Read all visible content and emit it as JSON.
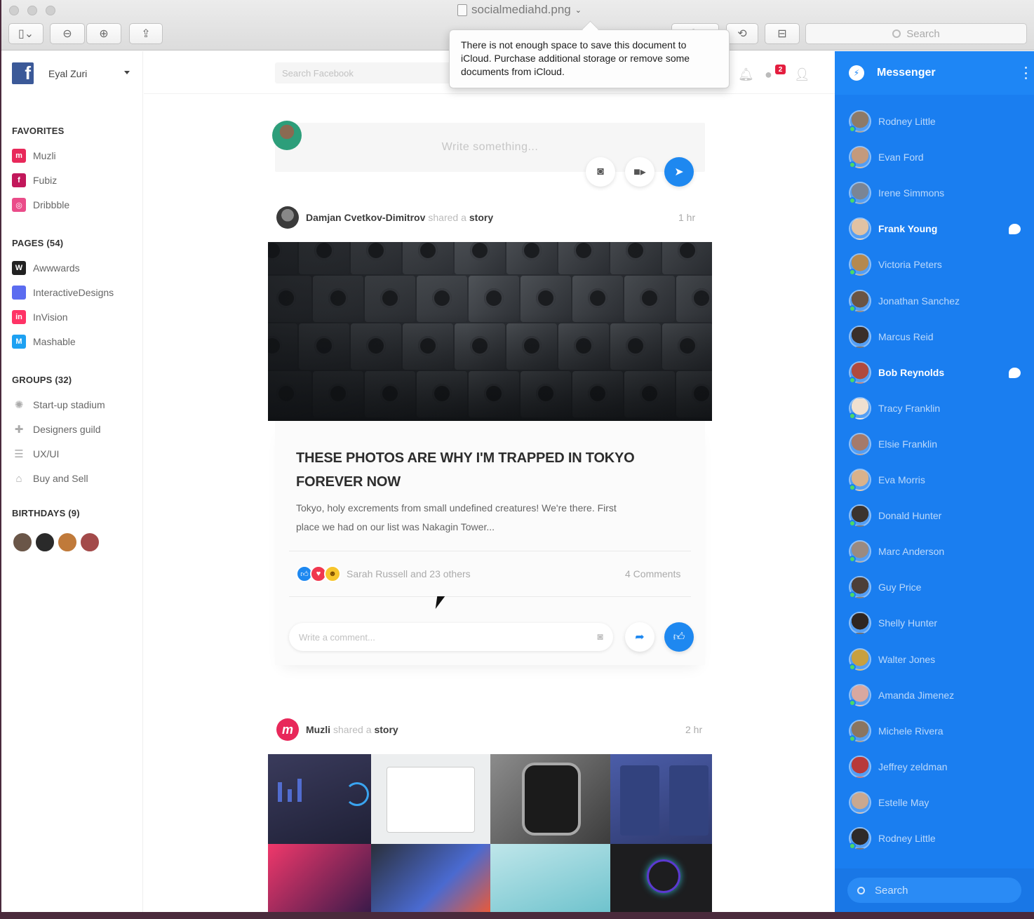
{
  "window": {
    "title": "socialmediahd.png",
    "toolbar_search_placeholder": "Search"
  },
  "tooltip": {
    "message": "There is not enough space to save this document to iCloud. Purchase additional storage or remove some documents from iCloud."
  },
  "profile": {
    "name": "Eyal Zuri"
  },
  "topbar": {
    "search_placeholder": "Search Facebook",
    "messages_badge": "2"
  },
  "sidebar": {
    "favorites_title": "FAVORITES",
    "favorites": [
      {
        "label": "Muzli",
        "icon": "muzli-icon",
        "color": "#e8285a",
        "glyph": "m"
      },
      {
        "label": "Fubiz",
        "icon": "fubiz-icon",
        "color": "#c2185b",
        "glyph": "f"
      },
      {
        "label": "Dribbble",
        "icon": "dribbble-icon",
        "color": "#ea4c89",
        "glyph": "◎"
      }
    ],
    "pages_title": "PAGES (54)",
    "pages": [
      {
        "label": "Awwwards",
        "icon": "awwwards-icon",
        "color": "#222222",
        "glyph": "W"
      },
      {
        "label": "InteractiveDesigns",
        "icon": "interactivedesigns-icon",
        "color": "#5b6cf0",
        "glyph": ""
      },
      {
        "label": "InVision",
        "icon": "invision-icon",
        "color": "#ff3366",
        "glyph": "in"
      },
      {
        "label": "Mashable",
        "icon": "mashable-icon",
        "color": "#1da1f2",
        "glyph": "M"
      }
    ],
    "groups_title": "GROUPS (32)",
    "groups": [
      {
        "label": "Start-up stadium",
        "icon": "lightbulb-icon",
        "glyph": "✺"
      },
      {
        "label": "Designers guild",
        "icon": "puzzle-icon",
        "glyph": "✚"
      },
      {
        "label": "UX/UI",
        "icon": "server-icon",
        "glyph": "☰"
      },
      {
        "label": "Buy and Sell",
        "icon": "basket-icon",
        "glyph": "⌂"
      }
    ],
    "birthdays_title": "BIRTHDAYS (9)"
  },
  "composer": {
    "placeholder": "Write something..."
  },
  "post1": {
    "author": "Damjan Cvetkov-Dimitrov",
    "action": "shared a",
    "object": "story",
    "time": "1 hr",
    "headline": "THESE PHOTOS ARE WHY I'M TRAPPED IN TOKYO FOREVER NOW",
    "excerpt": "Tokyo, holy excrements from small undefined creatures! We're there. First place we had on our list was Nakagin Tower...",
    "reactions": "Sarah Russell and 23 others",
    "comments": "4 Comments",
    "comment_placeholder": "Write a comment..."
  },
  "post2": {
    "author": "Muzli",
    "action": "shared a",
    "object": "story",
    "time": "2 hr"
  },
  "messenger": {
    "title": "Messenger",
    "search_placeholder": "Search",
    "contacts": [
      {
        "name": "Rodney Little",
        "bold": false,
        "unread": false,
        "online": true,
        "color": "#8d7a68"
      },
      {
        "name": "Evan Ford",
        "bold": false,
        "unread": false,
        "online": true,
        "color": "#c49a7c"
      },
      {
        "name": "Irene Simmons",
        "bold": false,
        "unread": false,
        "online": true,
        "color": "#7a8595"
      },
      {
        "name": "Frank Young",
        "bold": true,
        "unread": true,
        "online": false,
        "color": "#e0c2a4"
      },
      {
        "name": "Victoria Peters",
        "bold": false,
        "unread": false,
        "online": true,
        "color": "#b5894f"
      },
      {
        "name": "Jonathan Sanchez",
        "bold": false,
        "unread": false,
        "online": true,
        "color": "#6a5444"
      },
      {
        "name": "Marcus Reid",
        "bold": false,
        "unread": false,
        "online": false,
        "color": "#3a2f2a"
      },
      {
        "name": "Bob Reynolds",
        "bold": true,
        "unread": true,
        "online": true,
        "color": "#b04a3e"
      },
      {
        "name": "Tracy Franklin",
        "bold": false,
        "unread": false,
        "online": true,
        "color": "#f0e0d0"
      },
      {
        "name": "Elsie Franklin",
        "bold": false,
        "unread": false,
        "online": false,
        "color": "#a57a6a"
      },
      {
        "name": "Eva Morris",
        "bold": false,
        "unread": false,
        "online": true,
        "color": "#d9b28c"
      },
      {
        "name": "Donald Hunter",
        "bold": false,
        "unread": false,
        "online": true,
        "color": "#3b332e"
      },
      {
        "name": "Marc Anderson",
        "bold": false,
        "unread": false,
        "online": true,
        "color": "#9a8a80"
      },
      {
        "name": "Guy Price",
        "bold": false,
        "unread": false,
        "online": true,
        "color": "#4c3f38"
      },
      {
        "name": "Shelly Hunter",
        "bold": false,
        "unread": false,
        "online": false,
        "color": "#2f2622"
      },
      {
        "name": "Walter Jones",
        "bold": false,
        "unread": false,
        "online": true,
        "color": "#c8a040"
      },
      {
        "name": "Amanda Jimenez",
        "bold": false,
        "unread": false,
        "online": true,
        "color": "#d8a8a0"
      },
      {
        "name": "Michele Rivera",
        "bold": false,
        "unread": false,
        "online": true,
        "color": "#8a7560"
      },
      {
        "name": "Jeffrey zeldman",
        "bold": false,
        "unread": false,
        "online": false,
        "color": "#b83a3a"
      },
      {
        "name": "Estelle May",
        "bold": false,
        "unread": false,
        "online": false,
        "color": "#c9a890"
      },
      {
        "name": "Rodney Little",
        "bold": false,
        "unread": false,
        "online": true,
        "color": "#2e2a28"
      }
    ]
  }
}
